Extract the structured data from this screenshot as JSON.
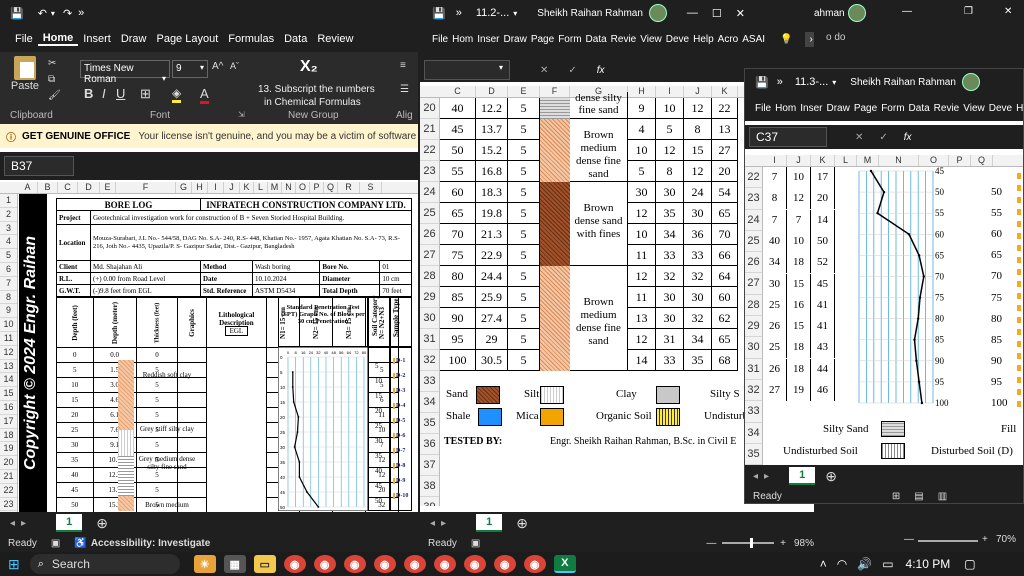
{
  "win1": {
    "title_icons": [
      "save-icon",
      "undo-icon",
      "redo-icon"
    ],
    "menu": [
      "File",
      "Home",
      "Insert",
      "Draw",
      "Page Layout",
      "Formulas",
      "Data",
      "Review"
    ],
    "font_name": "Times New Roman",
    "font_size": "9",
    "clipboard_label": "Clipboard",
    "font_label": "Font",
    "paste_label": "Paste",
    "newgroup_text1": "13. Subscript the numbers",
    "newgroup_text2": "in Chemical Formulas",
    "newgroup_label": "New Group",
    "subscript_glyph": "X₂",
    "alignment_label": "Alig",
    "warning_title": "GET GENUINE OFFICE",
    "warning_text": "Your license isn't genuine, and you may be a victim of software cou",
    "namebox": "B37",
    "cols": [
      "A",
      "B",
      "C",
      "D",
      "E",
      "F",
      "G",
      "H",
      "I",
      "J",
      "K",
      "L",
      "M",
      "N",
      "O",
      "P",
      "Q",
      "R",
      "S"
    ],
    "rows": [
      "1",
      "2",
      "3",
      "4",
      "5",
      "6",
      "7",
      "8",
      "9",
      "10",
      "11",
      "12",
      "13",
      "14",
      "15",
      "16",
      "17",
      "18",
      "19",
      "20",
      "21",
      "22",
      "23"
    ],
    "copyright": "Copyright © 2024 Engr. Raihan",
    "bore_log": "BORE LOG",
    "company": "INFRATECH CONSTRUCTION COMPANY LTD.",
    "project_label": "Project",
    "project": "Geotechnical investigation work for construction of B + Seven Storied Hospital Building.",
    "location_label": "Location",
    "location": "Mouza-Surabari, J.L No.- 544/58, DAG No. S.A- 240, R.S- 448, Khatian No.- 1957, Agata Khatian No. S.A- 73, R.S- 216, Joth No.- 4435, Upazila/P. S- Gazipur Sadar, Dist.- Gazipur, Bangladesh",
    "client_label": "Client",
    "client": "Md. Shajahan Ali",
    "method_label": "Method",
    "method": "Wash boring",
    "boreno_label": "Bore No.",
    "boreno": "01",
    "rl_label": "R.L.",
    "rl": "(+) 0.00 from Road Level",
    "date_label": "Date",
    "date": "10.10.2024",
    "diameter_label": "Diameter",
    "diameter": "10 cm",
    "gwt_label": "G.W.T.",
    "gwt": "(-)9.8 feet from EGL",
    "stdref_label": "Std. Reference",
    "stdref": "ASTM D5434",
    "totaldepth_label": "Total Depth",
    "totaldepth": "70 feet",
    "h_depth_ft": "Depth (feet)",
    "h_depth_m": "Depth (meter)",
    "h_thickness": "Thickness (feet)",
    "h_graphics": "Graphics",
    "h_litho": "Lithological Description",
    "egl": "EGL",
    "h_n1": "N1= 15 cm",
    "h_n2": "N2= 15 cm",
    "h_n3": "N3= 15 cm",
    "h_n": "N= N2+N3",
    "h_spt": "Standard Penetration Test (SPT) Graph No. of Blows per 30 cm Penetration",
    "h_soil": "Soil Category",
    "h_sample": "Sample Type",
    "spt_ticks": [
      "0",
      "8",
      "16",
      "24",
      "32",
      "40",
      "48",
      "56",
      "64",
      "72",
      "80"
    ],
    "spt_depths": [
      "0",
      "5",
      "10",
      "15",
      "20",
      "25",
      "30",
      "35",
      "40",
      "45",
      "50"
    ],
    "spt_depths_right": [
      "5",
      "10",
      "15",
      "20",
      "25",
      "30",
      "35",
      "40",
      "45",
      "50"
    ],
    "samples": [
      "D-1",
      "D-2",
      "D-3",
      "D-4",
      "D-5",
      "D-6",
      "D-7",
      "D-8",
      "D-9",
      "D-10"
    ],
    "table": [
      [
        "0",
        "0.0",
        "0",
        "",
        "",
        "",
        ""
      ],
      [
        "5",
        "1.5",
        "5",
        "1",
        "2",
        "3",
        "5"
      ],
      [
        "10",
        "3.0",
        "5",
        "1",
        "2",
        "3",
        "5"
      ],
      [
        "15",
        "4.6",
        "5",
        "2",
        "3",
        "3",
        "6"
      ],
      [
        "20",
        "6.1",
        "5",
        "3",
        "4",
        "7",
        "11"
      ],
      [
        "25",
        "7.6",
        "5",
        "3",
        "4",
        "6",
        "10"
      ],
      [
        "30",
        "9.1",
        "5",
        "3",
        "3",
        "4",
        "7"
      ],
      [
        "35",
        "10.7",
        "5",
        "4",
        "4",
        "8",
        "12"
      ],
      [
        "40",
        "12.2",
        "5",
        "4",
        "4",
        "8",
        "12"
      ],
      [
        "45",
        "13.7",
        "5",
        "7",
        "9",
        "11",
        "20"
      ],
      [
        "50",
        "15.2",
        "5",
        "11",
        "14",
        "18",
        "32"
      ]
    ],
    "descriptions": [
      "Reddish soft clay",
      "Grey stiff silty clay",
      "Grey medium dense silty fine sand",
      "Brown medium"
    ],
    "sheet_tab": "1",
    "status_ready": "Ready",
    "status_access": "Accessibility: Investigate"
  },
  "win2": {
    "title": "11.2-...",
    "user": "Sheikh Raihan Rahman",
    "menu": [
      "File",
      "Hom",
      "Inser",
      "Draw",
      "Page",
      "Form",
      "Data",
      "Revie",
      "View",
      "Deve",
      "Help",
      "Acro",
      "ASAI"
    ],
    "cols": [
      "C",
      "D",
      "E",
      "F",
      "G",
      "H",
      "I",
      "J",
      "K"
    ],
    "rows": [
      "20",
      "21",
      "22",
      "23",
      "24",
      "25",
      "26",
      "27",
      "28",
      "29",
      "30",
      "31",
      "32",
      "33",
      "34",
      "35",
      "36",
      "37",
      "38",
      "39"
    ],
    "data": [
      [
        "40",
        "12.2",
        "5",
        "9",
        "10",
        "12",
        "22"
      ],
      [
        "45",
        "13.7",
        "5",
        "4",
        "5",
        "8",
        "13"
      ],
      [
        "50",
        "15.2",
        "5",
        "10",
        "12",
        "15",
        "27"
      ],
      [
        "55",
        "16.8",
        "5",
        "5",
        "8",
        "12",
        "20"
      ],
      [
        "60",
        "18.3",
        "5",
        "30",
        "30",
        "24",
        "54"
      ],
      [
        "65",
        "19.8",
        "5",
        "12",
        "35",
        "30",
        "65"
      ],
      [
        "70",
        "21.3",
        "5",
        "10",
        "34",
        "36",
        "70"
      ],
      [
        "75",
        "22.9",
        "5",
        "11",
        "33",
        "33",
        "66"
      ],
      [
        "80",
        "24.4",
        "5",
        "12",
        "32",
        "32",
        "64"
      ],
      [
        "85",
        "25.9",
        "5",
        "11",
        "30",
        "30",
        "60"
      ],
      [
        "90",
        "27.4",
        "5",
        "13",
        "30",
        "32",
        "62"
      ],
      [
        "95",
        "29",
        "5",
        "12",
        "31",
        "34",
        "65"
      ],
      [
        "100",
        "30.5",
        "5",
        "14",
        "33",
        "35",
        "68"
      ]
    ],
    "desc_top": "dense silty fine sand",
    "desc_a": "Brown medium dense fine sand",
    "desc_b": "Brown dense sand with fines",
    "desc_c": "Brown medium dense fine sand",
    "legend1": [
      "Sand",
      "Silt",
      "Clay",
      "Silty S"
    ],
    "legend2": [
      "Shale",
      "Mica",
      "Organic Soil",
      "Undisturbed"
    ],
    "tested_label": "TESTED BY:",
    "tested": "Engr. Sheikh Raihan Rahman, B.Sc. in Civil E",
    "sheet_tab": "1",
    "status_ready": "Ready",
    "zoom": "98%"
  },
  "win3": {
    "title": "11.3-...",
    "user": "Sheikh Raihan Rahman",
    "menu": [
      "File",
      "Hom",
      "Inser",
      "Draw",
      "Page",
      "Form",
      "Data",
      "Revie",
      "View",
      "Deve",
      "He"
    ],
    "namebox": "C37",
    "cols": [
      "I",
      "J",
      "K",
      "L",
      "M",
      "N",
      "O",
      "P",
      "Q"
    ],
    "rows": [
      "22",
      "23",
      "24",
      "25",
      "26",
      "27",
      "28",
      "29",
      "30",
      "31",
      "32",
      "33",
      "34",
      "35"
    ],
    "data": [
      [
        "7",
        "10",
        "17"
      ],
      [
        "8",
        "12",
        "20"
      ],
      [
        "7",
        "7",
        "14"
      ],
      [
        "40",
        "10",
        "50"
      ],
      [
        "34",
        "18",
        "52"
      ],
      [
        "30",
        "15",
        "45"
      ],
      [
        "25",
        "16",
        "41"
      ],
      [
        "26",
        "15",
        "41"
      ],
      [
        "25",
        "18",
        "43"
      ],
      [
        "26",
        "18",
        "44"
      ],
      [
        "27",
        "19",
        "46"
      ]
    ],
    "axis_left": [
      "45",
      "50",
      "55",
      "60",
      "65",
      "70",
      "75",
      "80",
      "85",
      "90",
      "95",
      "100"
    ],
    "axis_right": [
      "50",
      "55",
      "60",
      "65",
      "70",
      "75",
      "80",
      "85",
      "90",
      "95",
      "100"
    ],
    "legend_silty": "Silty Sand",
    "legend_fill": "Fill",
    "legend_undist": "Undisturbed Soil",
    "legend_dist": "Disturbed Soil (D)",
    "sheet_tab": "1",
    "status_ready": "Ready",
    "zoom": "70%"
  },
  "taskbar": {
    "search": "Search",
    "time": "4:10 PM"
  },
  "colors": {
    "excel_green": "#107c41",
    "warning_yellow": "#fff4ce",
    "dark": "#1f1f1f",
    "grid_line": "#4aa8e0",
    "clay": "#f4c7a5",
    "dense_sand": "#8b4513"
  }
}
